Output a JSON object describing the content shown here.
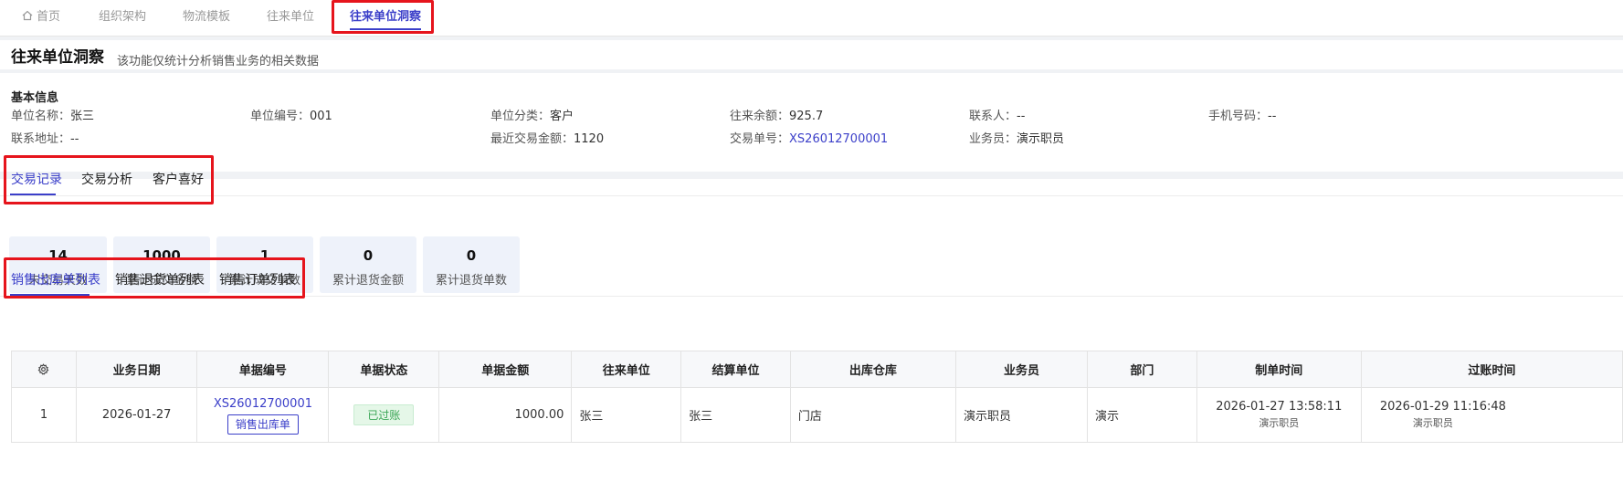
{
  "top_tabs": [
    {
      "label": "首页",
      "icon": "home-icon"
    },
    {
      "label": "组织架构"
    },
    {
      "label": "物流模板"
    },
    {
      "label": "往来单位"
    },
    {
      "label": "往来单位洞察",
      "active": true
    }
  ],
  "page": {
    "title": "往来单位洞察",
    "description": "该功能仅统计分析销售业务的相关数据"
  },
  "basic_info": {
    "section_title": "基本信息",
    "fields": [
      {
        "key": "单位名称：",
        "value": "张三"
      },
      {
        "key": "单位编号：",
        "value": "001"
      },
      {
        "key": "单位分类：",
        "value": "客户"
      },
      {
        "key": "往来余额：",
        "value": "925.7"
      },
      {
        "key": "联系人：",
        "value": "--"
      },
      {
        "key": "手机号码：",
        "value": "--"
      },
      {
        "key": "联系地址：",
        "value": "--"
      },
      {
        "key": "最近交易金额：",
        "value": "1120"
      },
      {
        "key": "交易单号：",
        "value": "XS26012700001"
      },
      {
        "key": "业务员：",
        "value": "演示职员"
      }
    ]
  },
  "main_tabs": [
    {
      "label": "交易记录",
      "active": true
    },
    {
      "label": "交易分析"
    },
    {
      "label": "客户喜好"
    }
  ],
  "stats": [
    {
      "value": "14",
      "label": "未交易天数"
    },
    {
      "value": "1000",
      "label": "累计成交金额"
    },
    {
      "value": "1",
      "label": "累计成交单数"
    },
    {
      "value": "0",
      "label": "累计退货金额"
    },
    {
      "value": "0",
      "label": "累计退货单数"
    }
  ],
  "sub_tabs": [
    {
      "label": "销售出库单列表",
      "active": true
    },
    {
      "label": "销售退货单列表"
    },
    {
      "label": "销售订单列表"
    }
  ],
  "table": {
    "settings_icon": "gear-icon",
    "columns": [
      "业务日期",
      "单据编号",
      "单据状态",
      "单据金额",
      "往来单位",
      "结算单位",
      "出库仓库",
      "业务员",
      "部门",
      "制单时间",
      "过账时间"
    ],
    "rows": [
      {
        "index": "1",
        "date": "2026-01-27",
        "doc_no": "XS26012700001",
        "doc_type": "销售出库单",
        "status": "已过账",
        "amount": "1000.00",
        "partner": "张三",
        "settle": "张三",
        "warehouse": "门店",
        "salesman": "演示职员",
        "dept": "演示",
        "created_time": "2026-01-27 13:58:11",
        "created_by": "演示职员",
        "posted_time": "2026-01-29 11:16:48",
        "posted_by": "演示职员"
      }
    ]
  },
  "colors": {
    "accent": "#3b3fc9",
    "highlight_box": "#e6141c",
    "status_green": "#3aa655"
  }
}
